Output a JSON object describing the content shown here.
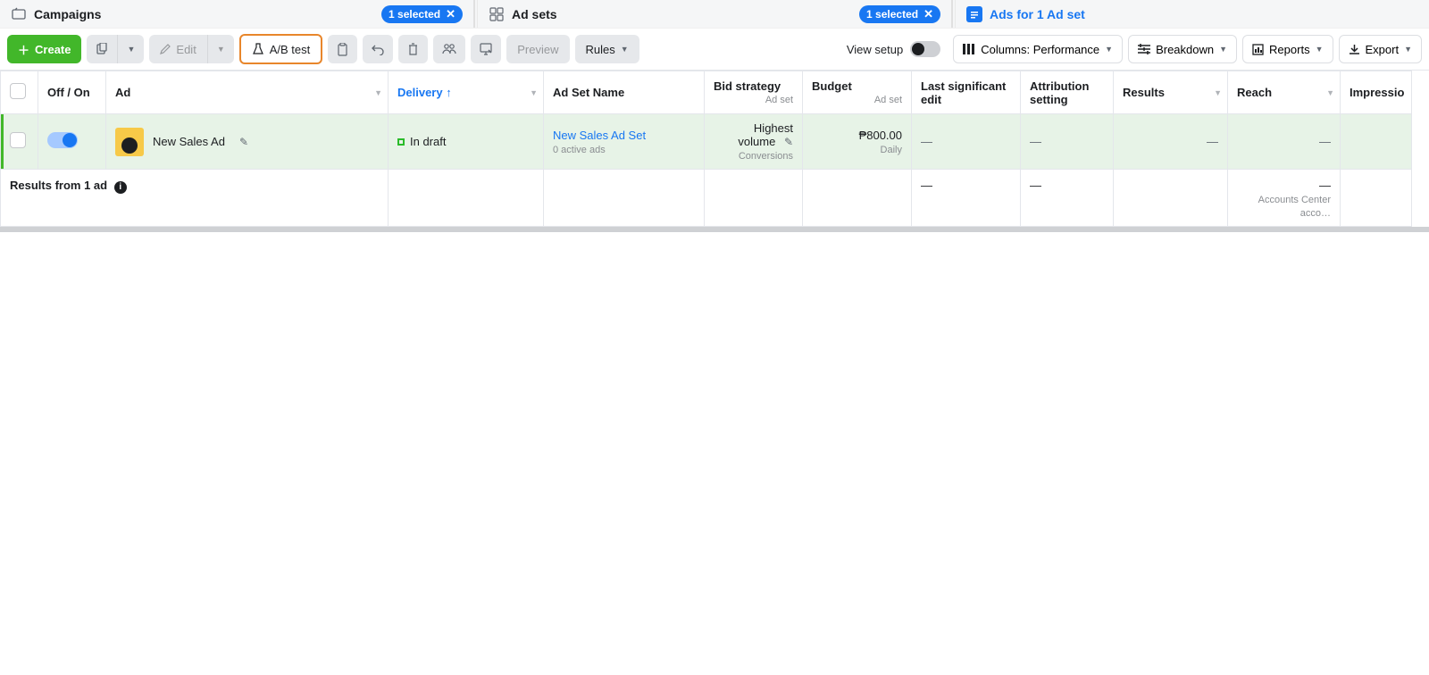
{
  "tabs": {
    "campaigns": {
      "label": "Campaigns",
      "badge": "1 selected"
    },
    "adsets": {
      "label": "Ad sets",
      "badge": "1 selected"
    },
    "ads": {
      "label": "Ads for 1 Ad set"
    }
  },
  "toolbar": {
    "create": "Create",
    "edit": "Edit",
    "abtest": "A/B test",
    "preview": "Preview",
    "rules": "Rules",
    "view_setup": "View setup",
    "columns": "Columns: Performance",
    "breakdown": "Breakdown",
    "reports": "Reports",
    "export": "Export"
  },
  "columns": {
    "onoff": "Off / On",
    "ad": "Ad",
    "delivery": "Delivery",
    "adset": "Ad Set Name",
    "bid": "Bid strategy",
    "bid_sub": "Ad set",
    "budget": "Budget",
    "budget_sub": "Ad set",
    "lastedit": "Last significant edit",
    "attribution": "Attribution setting",
    "results": "Results",
    "reach": "Reach",
    "impressions": "Impressio"
  },
  "rows": [
    {
      "ad_name": "New Sales Ad",
      "delivery": "In draft",
      "adset_name": "New Sales Ad Set",
      "adset_sub": "0 active ads",
      "bid": "Highest volume",
      "bid_sub": "Conversions",
      "budget": "₱800.00",
      "budget_sub": "Daily",
      "lastedit": "—",
      "attribution": "—",
      "results": "—",
      "reach": "—"
    }
  ],
  "summary": {
    "label": "Results from 1 ad",
    "lastedit": "—",
    "attribution": "—",
    "reach": "—",
    "reach_sub": "Accounts Center acco…"
  }
}
